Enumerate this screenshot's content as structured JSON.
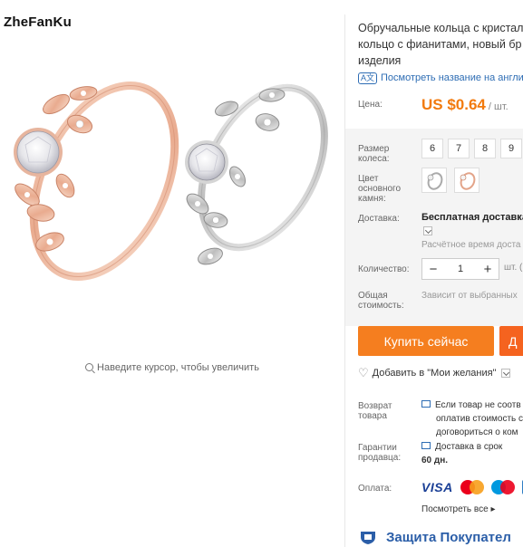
{
  "brand": "ZheFanKu",
  "zoom_hint": "Наведите курсор, чтобы увеличить",
  "product": {
    "title_lines": [
      "Обручальные кольца с кристал",
      "кольцо с фианитами, новый бр",
      "изделия"
    ],
    "translate_link": "Посмотреть название на англий"
  },
  "price": {
    "label": "Цена:",
    "amount": "US $0.64",
    "unit": "/ шт."
  },
  "size": {
    "label_lines": [
      "Размер",
      "колеса:"
    ],
    "options": [
      "6",
      "7",
      "8",
      "9"
    ]
  },
  "stone": {
    "label_lines": [
      "Цвет",
      "основного",
      "камня:"
    ],
    "options": [
      "silver-ring-thumbnail",
      "rose-gold-ring-thumbnail"
    ]
  },
  "delivery": {
    "label": "Доставка:",
    "value": "Бесплатная доставка",
    "estimate": "Расчётное время доста"
  },
  "quantity": {
    "label": "Количество:",
    "value": "1",
    "minus": "−",
    "plus": "+",
    "unit": "шт. ("
  },
  "total": {
    "label_lines": [
      "Общая",
      "стоимость:"
    ],
    "value": "Зависит от выбранных"
  },
  "actions": {
    "buy_now": "Купить сейчас",
    "add_to_cart": "Д",
    "wishlist": "Добавить в \"Мои желания\""
  },
  "return_policy": {
    "label_lines": [
      "Возврат",
      "товара"
    ],
    "lines": [
      "Если товар не соотв",
      "оплатив стоимость с",
      "договориться о ком"
    ]
  },
  "guarantee": {
    "label_lines": [
      "Гарантии",
      "продавца:"
    ],
    "lines": [
      "Доставка в срок",
      "60 дн."
    ]
  },
  "payment": {
    "label": "Оплата:",
    "methods": [
      "VISA",
      "mastercard",
      "maestro",
      "amex"
    ],
    "see_all": "Посмотреть все"
  },
  "protection": "Защита Покупател",
  "colors": {
    "accent_orange": "#f57e1f",
    "price_orange": "#f27a0d",
    "link_blue": "#2e6db4",
    "protection_blue": "#2b5ea8"
  }
}
